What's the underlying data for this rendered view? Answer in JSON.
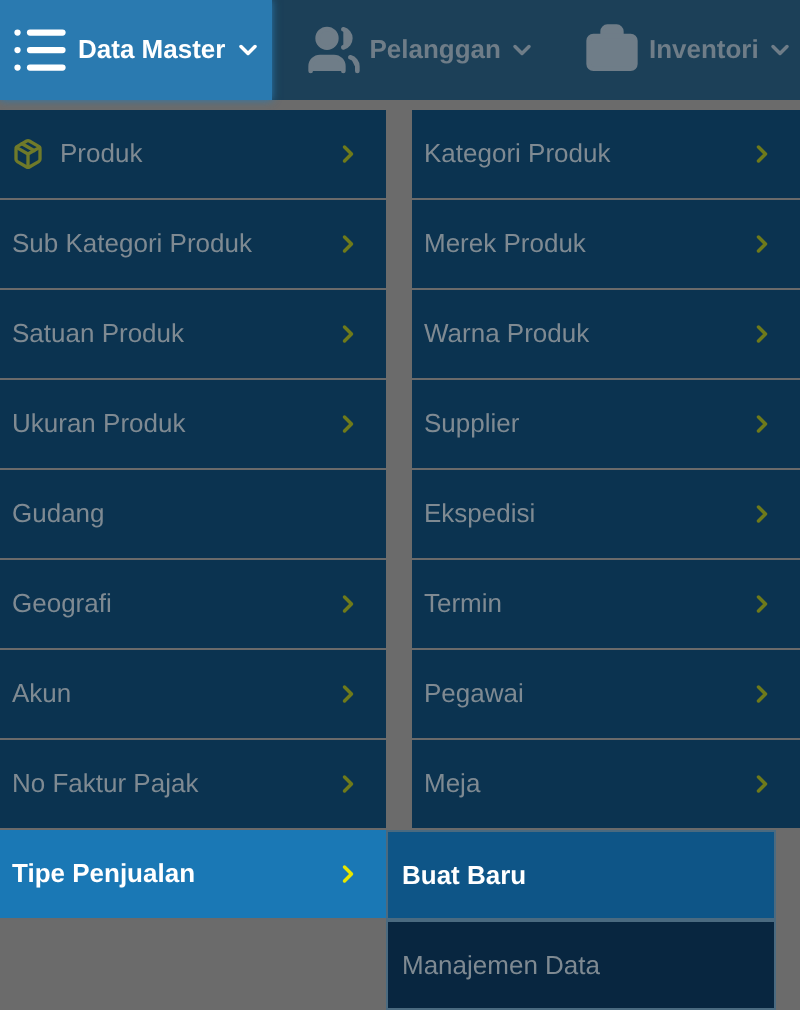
{
  "nav": [
    {
      "label": "Data Master",
      "selected": true,
      "kind": "list"
    },
    {
      "label": "Pelanggan",
      "selected": false,
      "kind": "users"
    },
    {
      "label": "Inventori",
      "selected": false,
      "kind": "briefcase"
    }
  ],
  "menu_columns": [
    {
      "items": [
        {
          "label": "Produk",
          "kind": "with-icon",
          "has_submenu": true,
          "selected": false
        },
        {
          "label": "Sub Kategori Produk",
          "kind": "plain",
          "has_submenu": true,
          "selected": false
        },
        {
          "label": "Satuan Produk",
          "kind": "plain",
          "has_submenu": true,
          "selected": false
        },
        {
          "label": "Ukuran Produk",
          "kind": "plain",
          "has_submenu": true,
          "selected": false
        },
        {
          "label": "Gudang",
          "kind": "plain",
          "has_submenu": false,
          "selected": false
        },
        {
          "label": "Geografi",
          "kind": "plain",
          "has_submenu": true,
          "selected": false
        },
        {
          "label": "Akun",
          "kind": "plain",
          "has_submenu": true,
          "selected": false
        },
        {
          "label": "No Faktur Pajak",
          "kind": "plain",
          "has_submenu": true,
          "selected": false
        },
        {
          "label": "Tipe Penjualan",
          "kind": "plain",
          "has_submenu": true,
          "selected": true
        }
      ]
    },
    {
      "items": [
        {
          "label": "Kategori Produk",
          "kind": "plain",
          "has_submenu": true,
          "selected": false
        },
        {
          "label": "Merek Produk",
          "kind": "plain",
          "has_submenu": true,
          "selected": false
        },
        {
          "label": "Warna Produk",
          "kind": "plain",
          "has_submenu": true,
          "selected": false
        },
        {
          "label": "Supplier",
          "kind": "plain",
          "has_submenu": true,
          "selected": false
        },
        {
          "label": "Ekspedisi",
          "kind": "plain",
          "has_submenu": true,
          "selected": false
        },
        {
          "label": "Termin",
          "kind": "plain",
          "has_submenu": true,
          "selected": false
        },
        {
          "label": "Pegawai",
          "kind": "plain",
          "has_submenu": true,
          "selected": false
        },
        {
          "label": "Meja",
          "kind": "plain",
          "has_submenu": true,
          "selected": false
        }
      ]
    }
  ],
  "submenu": [
    {
      "label": "Buat Baru",
      "selected": true
    },
    {
      "label": "Manajemen Data",
      "selected": false
    }
  ]
}
